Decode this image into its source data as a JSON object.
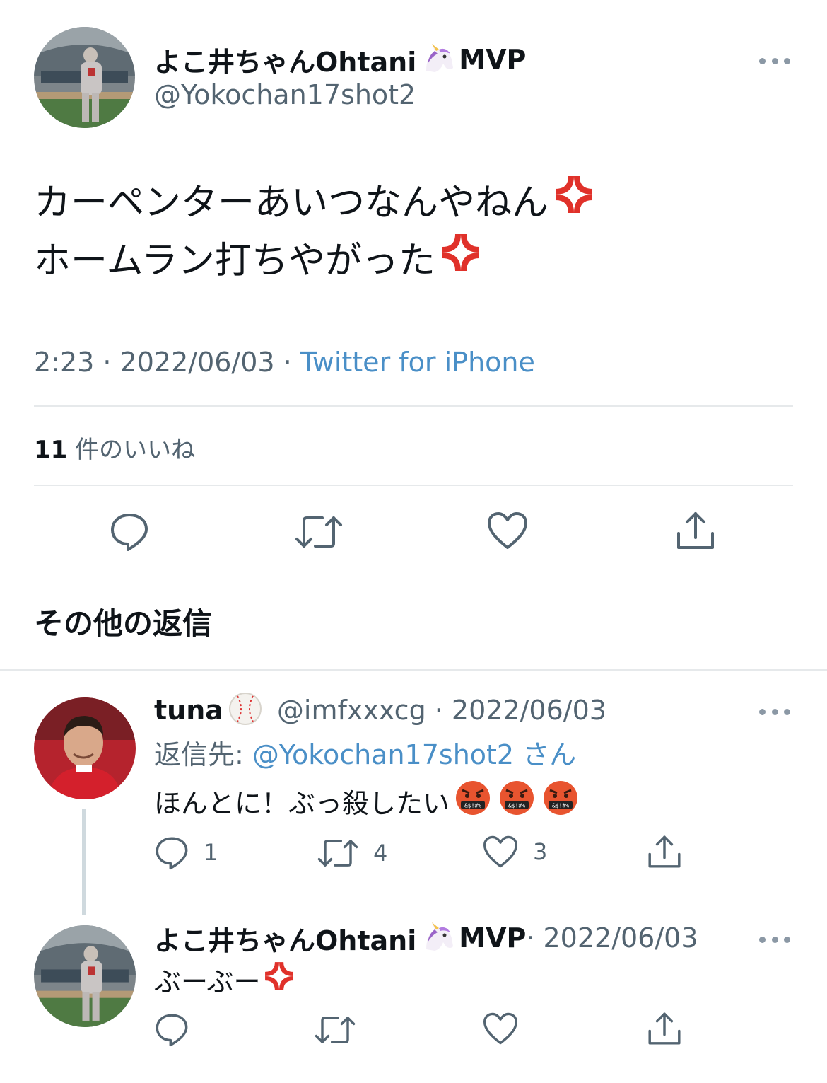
{
  "main_tweet": {
    "display_name": "よこ井ちゃんOhtani",
    "name_suffix": "MVP",
    "handle": "@Yokochan17shot2",
    "text_line1": "カーペンターあいつなんやねん",
    "text_line2": "ホームラン打ちやがった",
    "time": "2:23 · 2022/06/03 · ",
    "source": "Twitter for iPhone",
    "likes_count": "11",
    "likes_label": "件のいいね"
  },
  "section_title": "その他の返信",
  "replies": [
    {
      "display_name": "tuna",
      "handle_date": "@imfxxxcg · 2022/06/03",
      "reply_to_label": "返信先: ",
      "reply_to_handle": "@Yokochan17shot2",
      "reply_to_suffix": " さん",
      "text": "ほんとに！ぶっ殺したい",
      "reply_count": "1",
      "retweet_count": "4",
      "like_count": "3"
    },
    {
      "display_name": "よこ井ちゃんOhtani",
      "name_suffix": "MVP",
      "date": " · 2022/06/03",
      "text": "ぶーぶー"
    }
  ],
  "icons": {
    "reply": "reply-icon",
    "retweet": "retweet-icon",
    "like": "heart-icon",
    "share": "share-icon",
    "more": "more-icon",
    "anger": "anger-emoji",
    "cursing": "cursing-face-emoji",
    "unicorn": "unicorn-emoji",
    "baseball": "baseball-emoji"
  },
  "colors": {
    "text": "#0f1419",
    "secondary": "#536471",
    "link": "#4a8fc7",
    "divider": "#e6e9eb",
    "anger": "#e0312a"
  }
}
